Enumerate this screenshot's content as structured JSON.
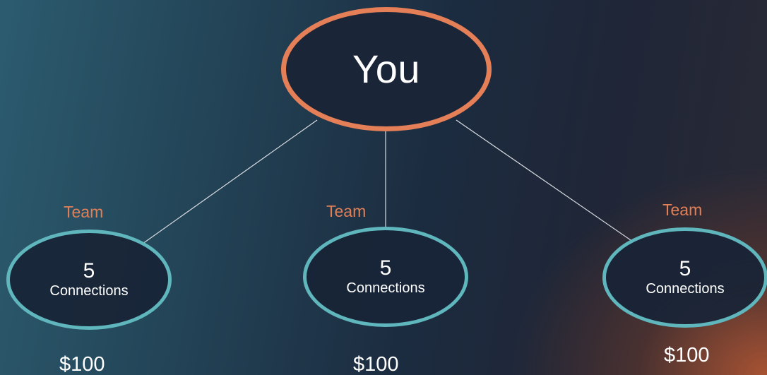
{
  "root": {
    "label": "You"
  },
  "teams": [
    {
      "team_label": "Team",
      "count": "5",
      "unit": "Connections",
      "price": "$100"
    },
    {
      "team_label": "Team",
      "count": "5",
      "unit": "Connections",
      "price": "$100"
    },
    {
      "team_label": "Team",
      "count": "5",
      "unit": "Connections",
      "price": "$100"
    }
  ],
  "colors": {
    "root_border": "#e47f57",
    "child_border": "#5fb6bc",
    "team_label": "#e08058",
    "connector": "#d8dde2"
  }
}
